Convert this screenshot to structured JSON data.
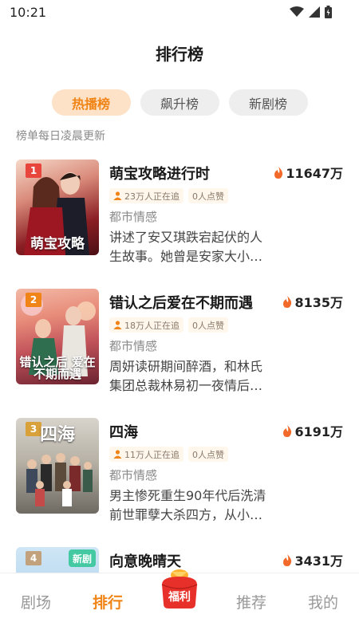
{
  "status": {
    "time": "10:21"
  },
  "header": {
    "title": "排行榜"
  },
  "tabs": [
    {
      "label": "热播榜",
      "active": true
    },
    {
      "label": "飙升榜",
      "active": false
    },
    {
      "label": "新剧榜",
      "active": false
    }
  ],
  "list_note": "榜单每日凌晨更新",
  "items": [
    {
      "rank": "1",
      "title": "萌宝攻略进行时",
      "heat": "11647万",
      "followers": "23万人正在追",
      "likes": "0人点赞",
      "genre": "都市情感",
      "desc": "讲述了安又琪跌宕起伏的人生故事。她曾是安家大小…",
      "cover_text": "萌宝攻略",
      "rank_color": "#e8453c"
    },
    {
      "rank": "2",
      "title": "错认之后爱在不期而遇",
      "heat": "8135万",
      "followers": "18万人正在追",
      "likes": "0人点赞",
      "genre": "都市情感",
      "desc": "周妍读研期间醉酒，和林氏集团总裁林易初一夜情后…",
      "cover_text": "错认之后 爱在不期而遇",
      "rank_color": "#f08416"
    },
    {
      "rank": "3",
      "title": "四海",
      "heat": "6191万",
      "followers": "11万人正在追",
      "likes": "0人点赞",
      "genre": "都市情感",
      "desc": "男主惨死重生90年代后洗清前世罪孽大杀四方，从小…",
      "cover_text": "四海",
      "rank_color": "#d9a13a"
    },
    {
      "rank": "4",
      "title": "向意晚晴天",
      "heat": "3431万",
      "badge": "新剧",
      "rank_color": "#c2a27c"
    }
  ],
  "nav": {
    "items": [
      "剧场",
      "排行",
      "推荐",
      "我的"
    ],
    "active": "排行",
    "fuli": "福利"
  },
  "colors": {
    "accent": "#f08416",
    "tab_active_bg": "#fde2c8",
    "new_badge": "#45c9a2"
  }
}
